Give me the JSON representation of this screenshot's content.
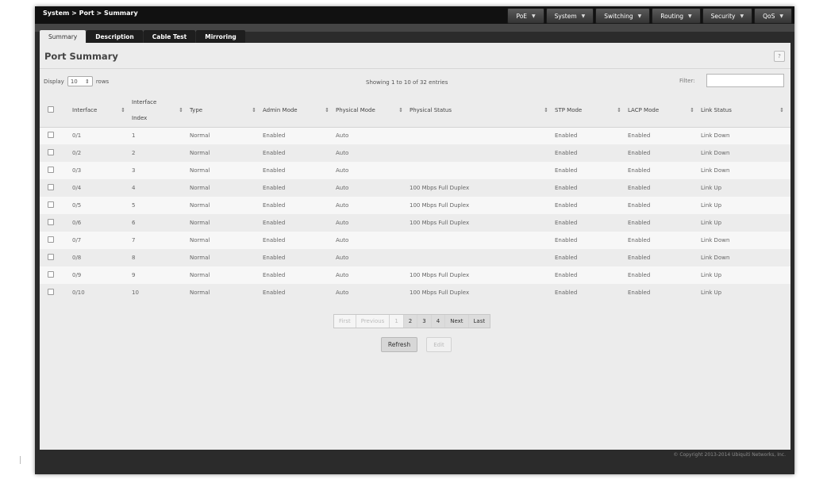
{
  "breadcrumb": "System > Port > Summary",
  "top_menu": [
    {
      "label": "PoE"
    },
    {
      "label": "System"
    },
    {
      "label": "Switching"
    },
    {
      "label": "Routing"
    },
    {
      "label": "Security"
    },
    {
      "label": "QoS"
    }
  ],
  "tabs": [
    {
      "label": "Summary",
      "active": true
    },
    {
      "label": "Description",
      "active": false
    },
    {
      "label": "Cable Test",
      "active": false
    },
    {
      "label": "Mirroring",
      "active": false
    }
  ],
  "panel": {
    "title": "Port Summary",
    "help": "?",
    "display_label": "Display",
    "rows_value": "10",
    "rows_label": "rows",
    "showing": "Showing 1 to 10 of 32 entries",
    "filter_label": "Filter:",
    "filter_value": ""
  },
  "table": {
    "headers": {
      "interface": "Interface",
      "interface_index_1": "Interface",
      "interface_index_2": "Index",
      "type": "Type",
      "admin_mode": "Admin Mode",
      "physical_mode": "Physical Mode",
      "physical_status": "Physical Status",
      "stp_mode": "STP Mode",
      "lacp_mode": "LACP Mode",
      "link_status": "Link Status"
    },
    "rows": [
      {
        "interface": "0/1",
        "index": "1",
        "type": "Normal",
        "admin": "Enabled",
        "phys_mode": "Auto",
        "phys_status": "",
        "stp": "Enabled",
        "lacp": "Enabled",
        "link": "Link Down"
      },
      {
        "interface": "0/2",
        "index": "2",
        "type": "Normal",
        "admin": "Enabled",
        "phys_mode": "Auto",
        "phys_status": "",
        "stp": "Enabled",
        "lacp": "Enabled",
        "link": "Link Down"
      },
      {
        "interface": "0/3",
        "index": "3",
        "type": "Normal",
        "admin": "Enabled",
        "phys_mode": "Auto",
        "phys_status": "",
        "stp": "Enabled",
        "lacp": "Enabled",
        "link": "Link Down"
      },
      {
        "interface": "0/4",
        "index": "4",
        "type": "Normal",
        "admin": "Enabled",
        "phys_mode": "Auto",
        "phys_status": "100 Mbps Full Duplex",
        "stp": "Enabled",
        "lacp": "Enabled",
        "link": "Link Up"
      },
      {
        "interface": "0/5",
        "index": "5",
        "type": "Normal",
        "admin": "Enabled",
        "phys_mode": "Auto",
        "phys_status": "100 Mbps Full Duplex",
        "stp": "Enabled",
        "lacp": "Enabled",
        "link": "Link Up"
      },
      {
        "interface": "0/6",
        "index": "6",
        "type": "Normal",
        "admin": "Enabled",
        "phys_mode": "Auto",
        "phys_status": "100 Mbps Full Duplex",
        "stp": "Enabled",
        "lacp": "Enabled",
        "link": "Link Up"
      },
      {
        "interface": "0/7",
        "index": "7",
        "type": "Normal",
        "admin": "Enabled",
        "phys_mode": "Auto",
        "phys_status": "",
        "stp": "Enabled",
        "lacp": "Enabled",
        "link": "Link Down"
      },
      {
        "interface": "0/8",
        "index": "8",
        "type": "Normal",
        "admin": "Enabled",
        "phys_mode": "Auto",
        "phys_status": "",
        "stp": "Enabled",
        "lacp": "Enabled",
        "link": "Link Down"
      },
      {
        "interface": "0/9",
        "index": "9",
        "type": "Normal",
        "admin": "Enabled",
        "phys_mode": "Auto",
        "phys_status": "100 Mbps Full Duplex",
        "stp": "Enabled",
        "lacp": "Enabled",
        "link": "Link Up"
      },
      {
        "interface": "0/10",
        "index": "10",
        "type": "Normal",
        "admin": "Enabled",
        "phys_mode": "Auto",
        "phys_status": "100 Mbps Full Duplex",
        "stp": "Enabled",
        "lacp": "Enabled",
        "link": "Link Up"
      }
    ]
  },
  "pagination": [
    {
      "label": "First",
      "state": "disabled"
    },
    {
      "label": "Previous",
      "state": "disabled"
    },
    {
      "label": "1",
      "state": "current"
    },
    {
      "label": "2",
      "state": "enabled"
    },
    {
      "label": "3",
      "state": "enabled"
    },
    {
      "label": "4",
      "state": "enabled"
    },
    {
      "label": "Next",
      "state": "enabled"
    },
    {
      "label": "Last",
      "state": "enabled"
    }
  ],
  "buttons": {
    "refresh": "Refresh",
    "edit": "Edit"
  },
  "footer": {
    "copyright": "© Copyright 2013-2014 Ubiquiti Networks, Inc."
  },
  "icons": {
    "caret": "caret-down-icon",
    "sort": "sort-icon"
  }
}
